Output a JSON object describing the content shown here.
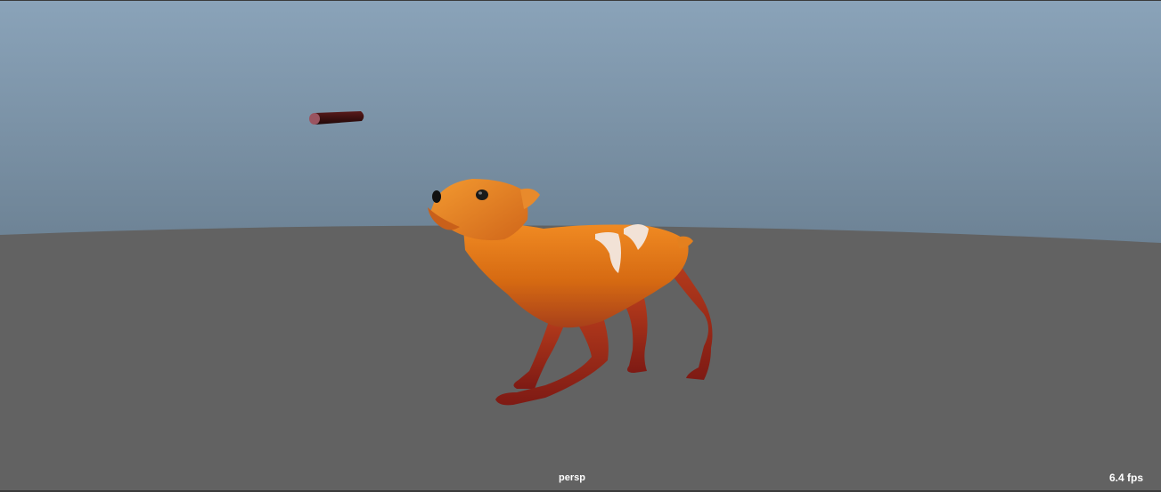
{
  "viewport": {
    "camera_name": "persp",
    "fps": "6.4 fps"
  },
  "colors": {
    "sky_top": "#87a0b6",
    "sky_bottom": "#6e8497",
    "ground": "#626262",
    "dog_body": "#e07a1a",
    "dog_legs": "#8c1e14",
    "stick": "#3a1212"
  },
  "scene_objects": [
    "dog-model",
    "floating-stick",
    "ground-plane"
  ]
}
